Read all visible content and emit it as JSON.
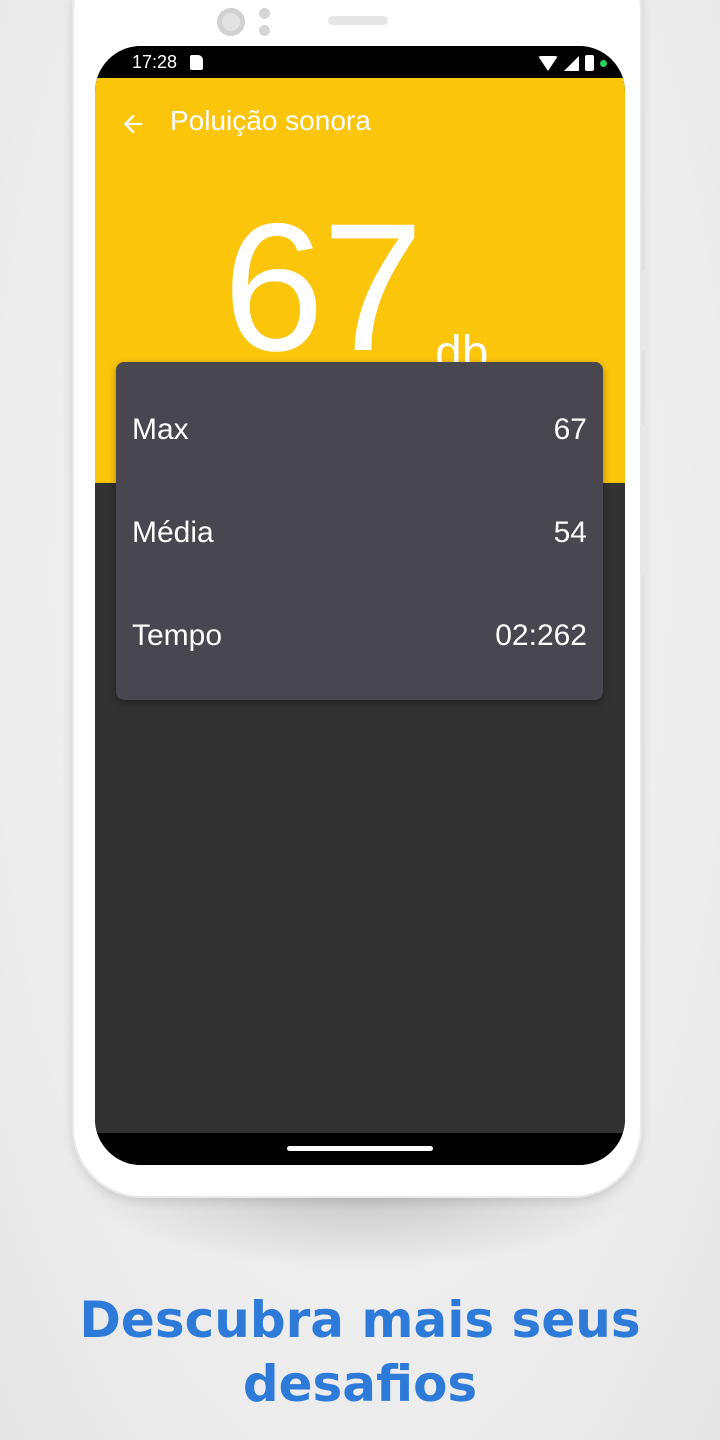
{
  "status_bar": {
    "time": "17:28",
    "icons": [
      "sd-card-icon",
      "wifi-icon",
      "signal-icon",
      "battery-icon",
      "privacy-dot-icon"
    ]
  },
  "app_bar": {
    "back_icon": "arrow-left-icon",
    "title": "Poluição sonora"
  },
  "meter": {
    "value": "67",
    "unit": "db"
  },
  "stats": [
    {
      "label": "Max",
      "value": "67"
    },
    {
      "label": "Média",
      "value": "54"
    },
    {
      "label": "Tempo",
      "value": "02:262"
    }
  ],
  "fab": {
    "icon": "pause-icon"
  },
  "promo": {
    "line1": "Descubra mais seus",
    "line2": "desafios"
  },
  "colors": {
    "accent_yellow": "#fbc50c",
    "dark_background": "#323232",
    "card": "#48464f",
    "fab_pink": "#fe3f80",
    "promo_blue": "#2e7ad8"
  }
}
